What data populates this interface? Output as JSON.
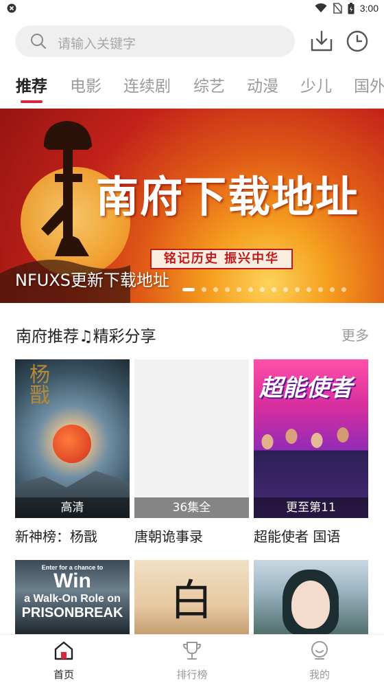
{
  "status_bar": {
    "time": "3:00"
  },
  "search": {
    "placeholder": "请输入关键字"
  },
  "tabs": [
    {
      "label": "推荐",
      "active": true
    },
    {
      "label": "电影"
    },
    {
      "label": "连续剧"
    },
    {
      "label": "综艺"
    },
    {
      "label": "动漫"
    },
    {
      "label": "少儿"
    },
    {
      "label": "国外"
    }
  ],
  "banner": {
    "title": "南府下载地址",
    "slogan": "铭记历史  振兴中华",
    "caption": "NFUXS更新下载地址",
    "dot_count": 14,
    "active_dot": 0
  },
  "section": {
    "title": "南府推荐♫精彩分享",
    "more_label": "更多"
  },
  "cards": [
    {
      "title": "新神榜：杨戬",
      "badge": "高清",
      "poster_text": "杨戬"
    },
    {
      "title": "唐朝诡事录",
      "badge": "36集全"
    },
    {
      "title": "超能使者 国语",
      "badge": "更至第11",
      "poster_text": "超能使者"
    },
    {
      "poster_text_line1": "Enter for a chance to",
      "poster_text_line2": "Win",
      "poster_text_line3": "a Walk-On Role on",
      "poster_text_line4": "PRISONBREAK"
    },
    {
      "poster_text": "白蛇"
    },
    {}
  ],
  "bottom_nav": [
    {
      "label": "首页",
      "active": true
    },
    {
      "label": "排行榜"
    },
    {
      "label": "我的"
    }
  ],
  "colors": {
    "accent": "#d7263d",
    "banner_red": "#c2221a"
  }
}
